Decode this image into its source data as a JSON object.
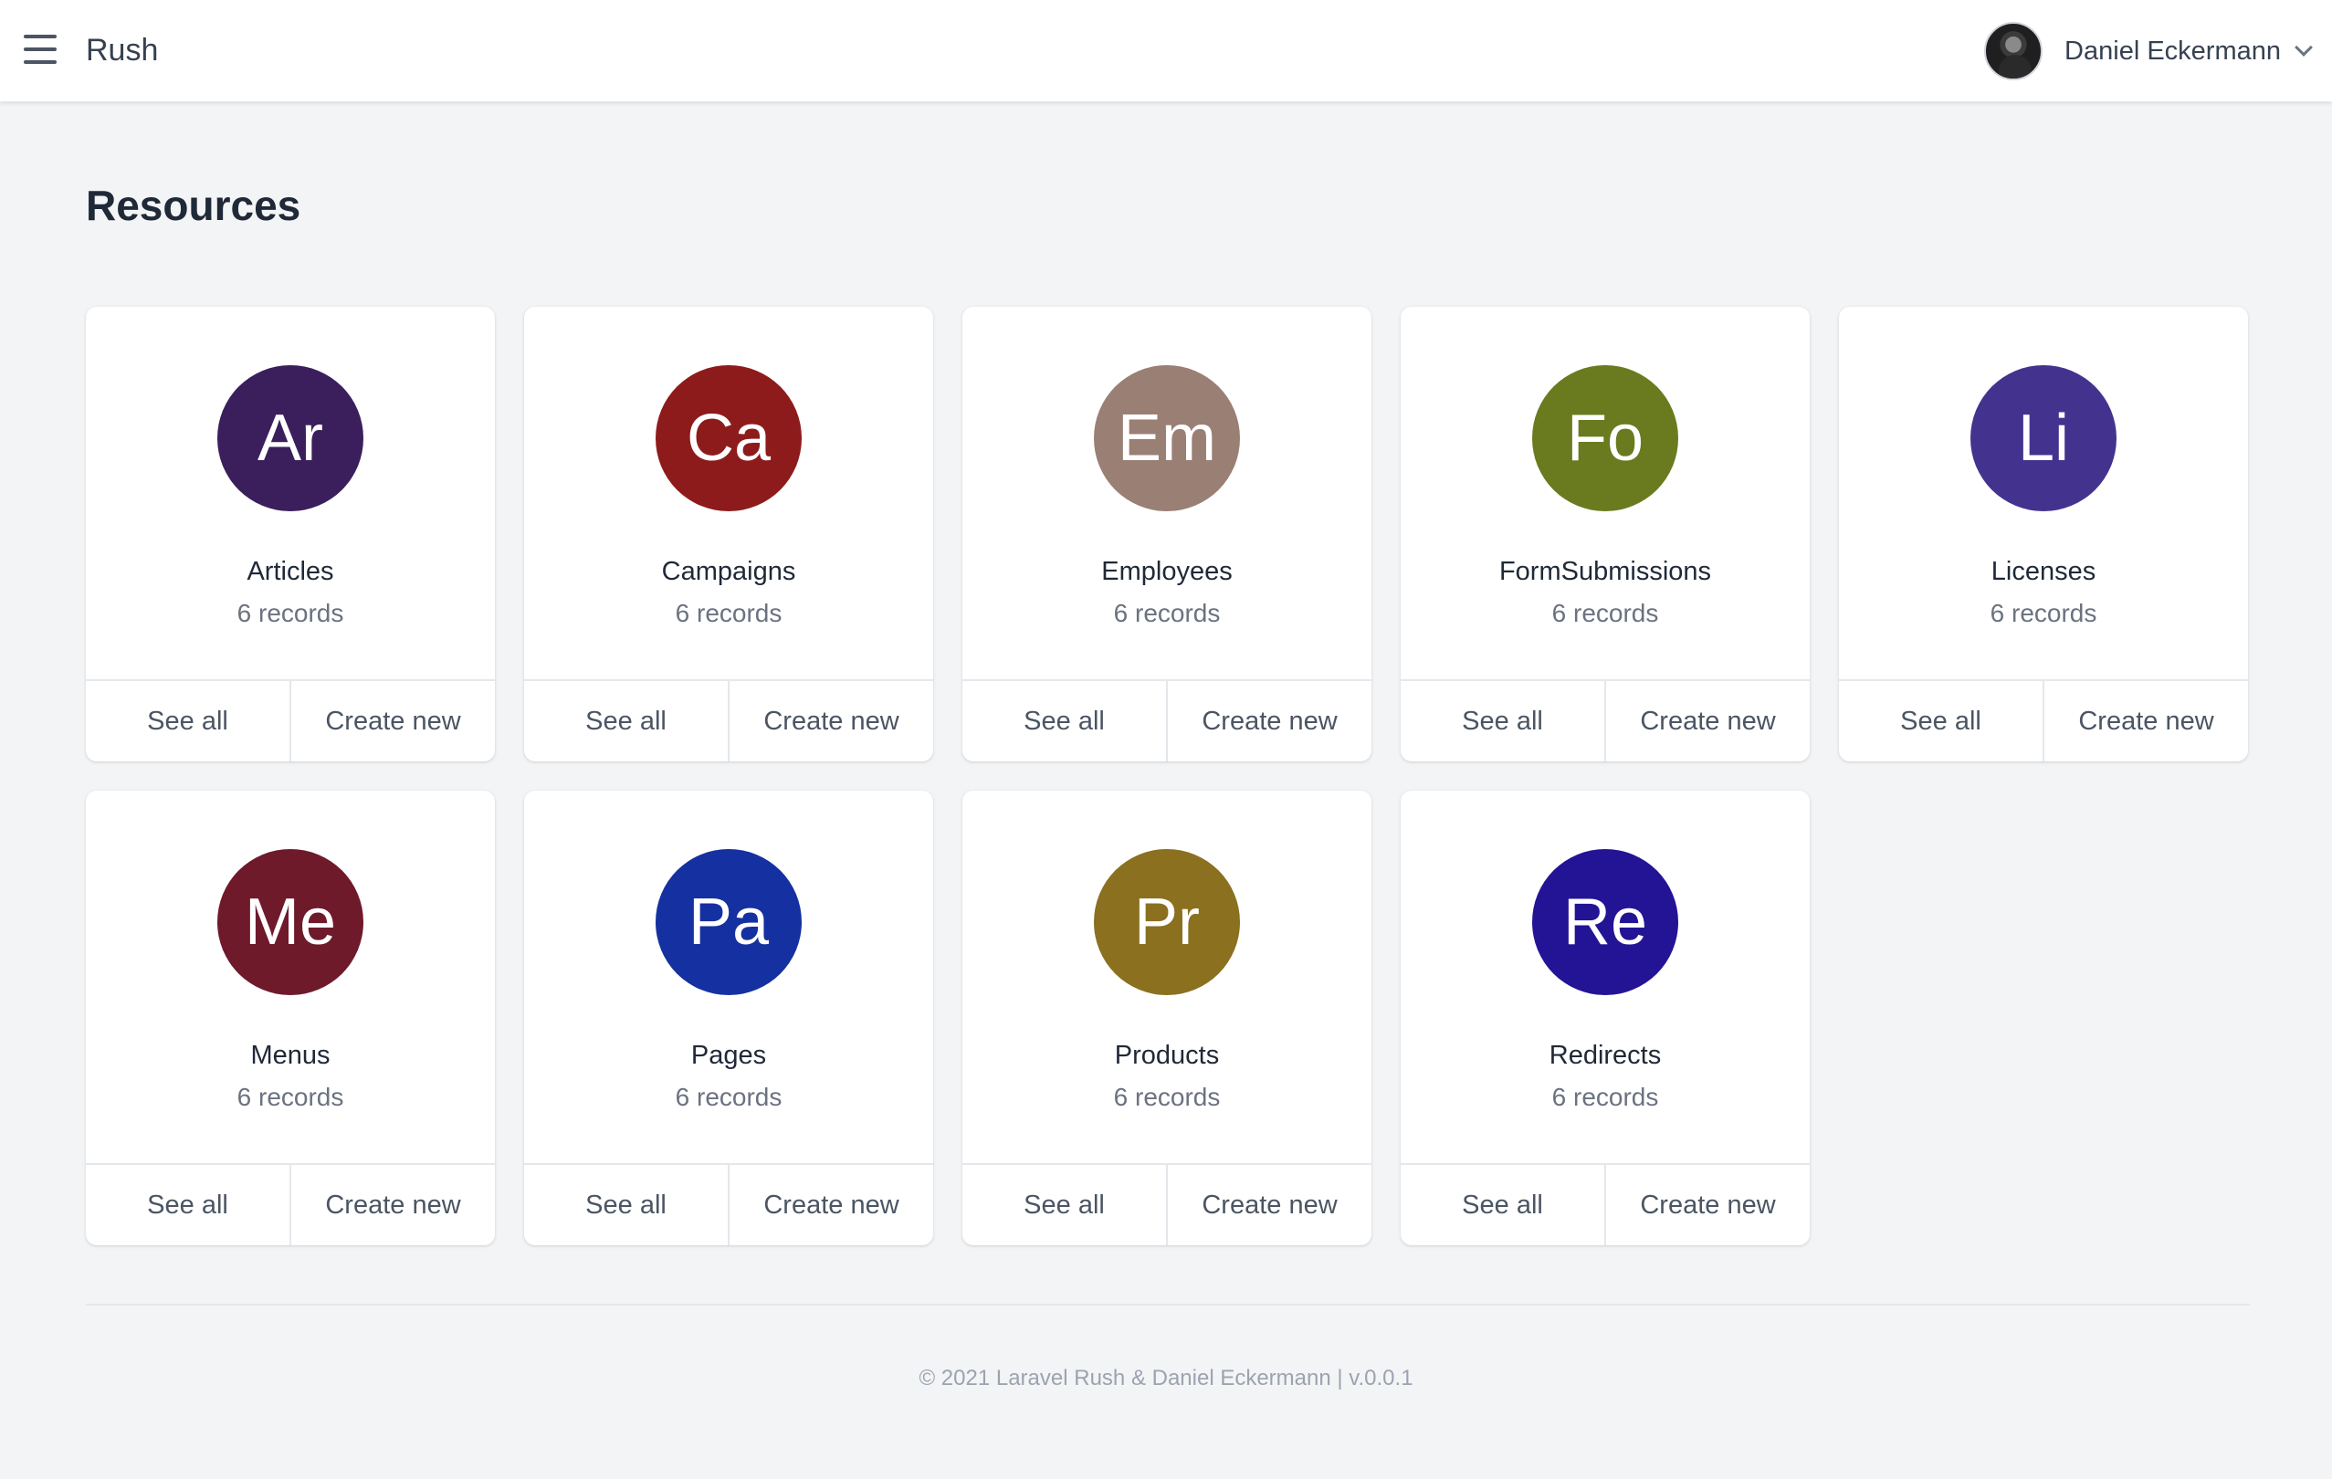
{
  "header": {
    "app_title": "Rush",
    "user_name": "Daniel Eckermann"
  },
  "main": {
    "title": "Resources",
    "see_all_label": "See all",
    "create_new_label": "Create new",
    "resources": [
      {
        "initials": "Ar",
        "name": "Articles",
        "count": "6 records",
        "color": "#3b1f5c"
      },
      {
        "initials": "Ca",
        "name": "Campaigns",
        "count": "6 records",
        "color": "#8e1b1b"
      },
      {
        "initials": "Em",
        "name": "Employees",
        "count": "6 records",
        "color": "#9a7f75"
      },
      {
        "initials": "Fo",
        "name": "FormSubmissions",
        "count": "6 records",
        "color": "#6a7a1f"
      },
      {
        "initials": "Li",
        "name": "Licenses",
        "count": "6 records",
        "color": "#43338f"
      },
      {
        "initials": "Me",
        "name": "Menus",
        "count": "6 records",
        "color": "#6e1a2b"
      },
      {
        "initials": "Pa",
        "name": "Pages",
        "count": "6 records",
        "color": "#1530a0"
      },
      {
        "initials": "Pr",
        "name": "Products",
        "count": "6 records",
        "color": "#8a701f"
      },
      {
        "initials": "Re",
        "name": "Redirects",
        "count": "6 records",
        "color": "#231496"
      }
    ]
  },
  "footer": {
    "text": "© 2021 Laravel Rush & Daniel Eckermann | v.0.0.1"
  }
}
